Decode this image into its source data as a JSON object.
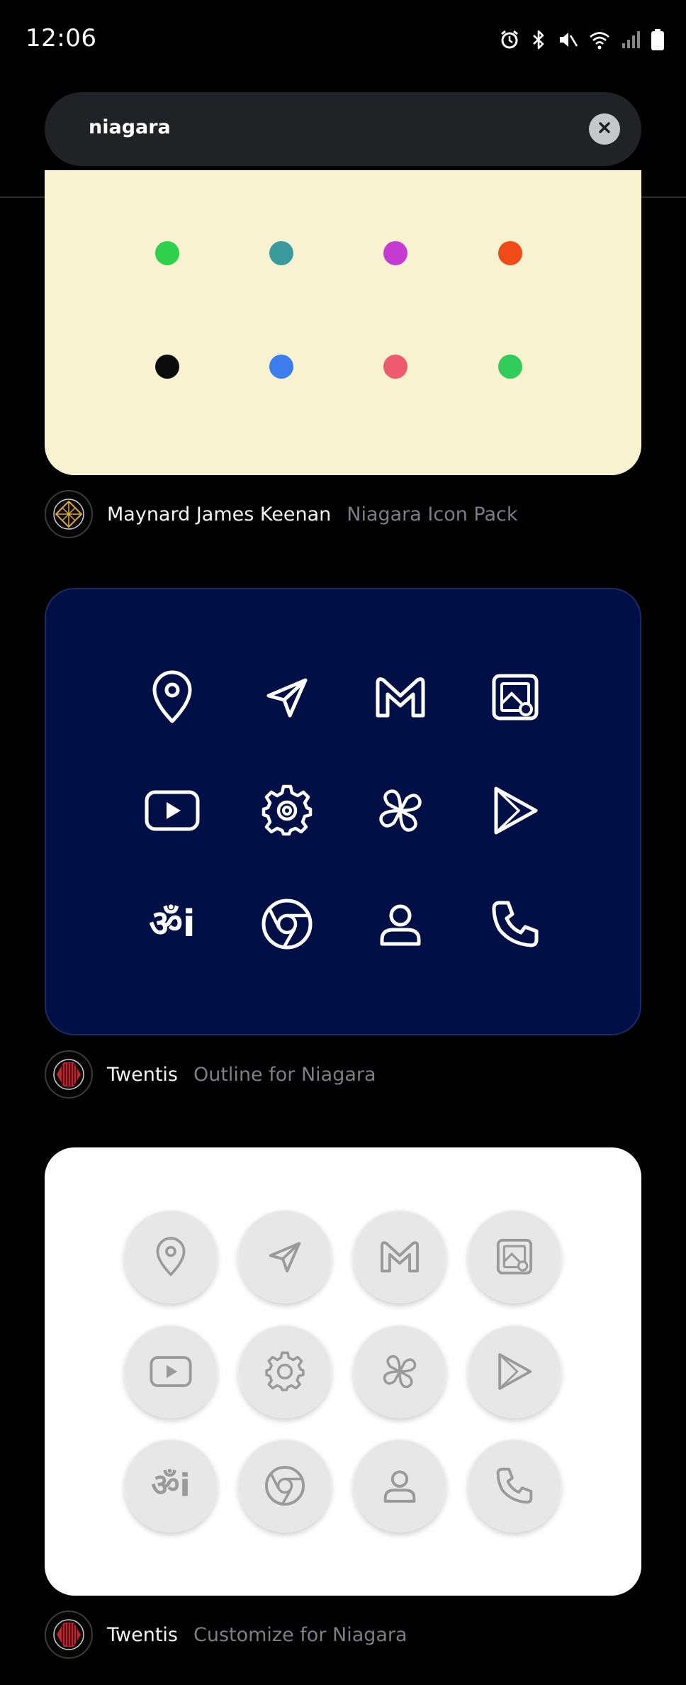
{
  "status_bar": {
    "time": "12:06",
    "icons": [
      "alarm-icon",
      "bluetooth-icon",
      "mute-icon",
      "wifi-icon",
      "signal-icon",
      "battery-icon"
    ]
  },
  "search": {
    "query": "niagara",
    "clear_icon": "close-icon"
  },
  "results": [
    {
      "author": "Maynard James Keenan",
      "pack": "Niagara Icon Pack",
      "preview_style": "color-dots",
      "background": "#f8f2d1",
      "dots": [
        "#2fd14b",
        "#3a9a9c",
        "#c53ad1",
        "#f04a16",
        "#0c0c0c",
        "#3b7ded",
        "#ee5a6f",
        "#2fcc57"
      ]
    },
    {
      "author": "Twentis",
      "pack": "Outline for Niagara",
      "preview_style": "outline-icons",
      "background": "#000f45",
      "icons": [
        "map-pin-icon",
        "send-icon",
        "gmail-icon",
        "gallery-icon",
        "youtube-icon",
        "settings-icon",
        "pinwheel-icon",
        "play-store-icon",
        "translate-icon",
        "chrome-icon",
        "contacts-icon",
        "phone-icon"
      ],
      "translate_glyph": "ॐi"
    },
    {
      "author": "Twentis",
      "pack": "Customize for Niagara",
      "preview_style": "neumorphic-icons",
      "background": "#ffffff",
      "icons": [
        "map-pin-icon",
        "send-icon",
        "gmail-icon",
        "gallery-icon",
        "youtube-icon",
        "settings-icon",
        "pinwheel-icon",
        "play-store-icon",
        "translate-icon",
        "chrome-icon",
        "contacts-icon",
        "phone-icon"
      ],
      "translate_glyph": "ॐi"
    }
  ]
}
